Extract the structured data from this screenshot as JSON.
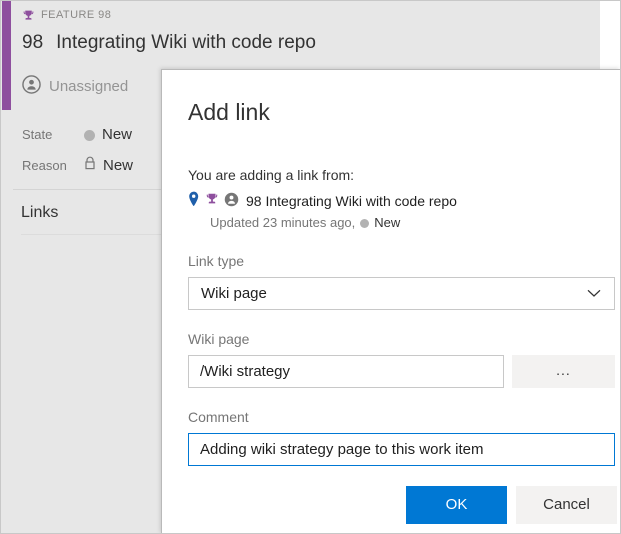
{
  "work_item": {
    "type_label": "FEATURE 98",
    "type_icon": "trophy-icon",
    "id": "98",
    "title": "Integrating Wiki with code repo",
    "assigned_to": "Unassigned",
    "assigned_icon": "person-avatar-icon",
    "fields": [
      {
        "label": "State",
        "value": "New",
        "icon": "state-dot-icon"
      },
      {
        "label": "Reason",
        "value": "New",
        "icon": "lock-icon"
      }
    ],
    "links_heading": "Links"
  },
  "dialog": {
    "title": "Add link",
    "intro_text": "You are adding a link from:",
    "reference": {
      "pin_icon": "location-pin-icon",
      "trophy_icon": "trophy-icon",
      "avatar_icon": "person-avatar-icon",
      "text": "98 Integrating Wiki with code repo",
      "updated_text": "Updated 23 minutes ago,",
      "state": "New",
      "state_dot_icon": "state-dot-icon"
    },
    "link_type": {
      "label": "Link type",
      "value": "Wiki page",
      "options": [
        "Wiki page"
      ],
      "chevron_icon": "chevron-down-icon"
    },
    "wiki_page": {
      "label": "Wiki page",
      "value": "/Wiki strategy",
      "placeholder": "",
      "browse_label": "..."
    },
    "comment": {
      "label": "Comment",
      "value": "Adding wiki strategy page to this work item",
      "placeholder": ""
    },
    "ok_label": "OK",
    "cancel_label": "Cancel"
  },
  "colors": {
    "accent_purple": "#8e4f9e",
    "primary_blue": "#0078d4",
    "page_background": "#e7e7e7",
    "state_dot": "#b2b2b2",
    "pin_blue": "#1f5faa",
    "trophy_purple": "#8e4f9e"
  }
}
